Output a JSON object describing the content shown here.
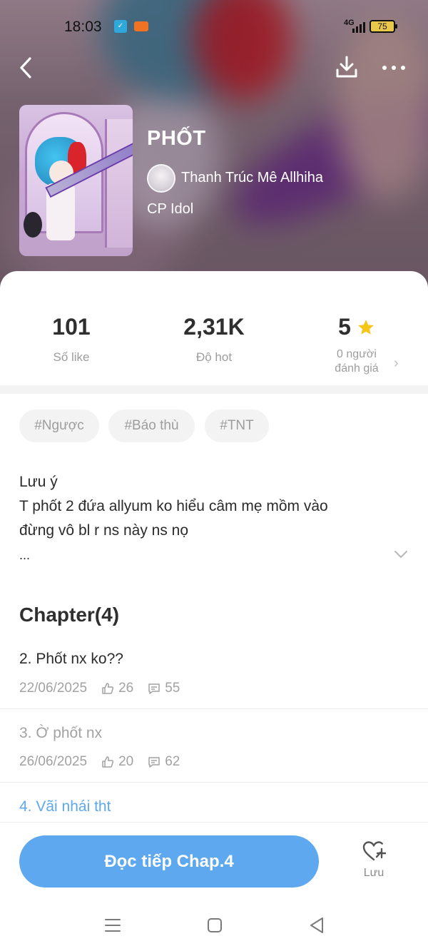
{
  "status_bar": {
    "time": "18:03",
    "network": "4G",
    "battery": "75"
  },
  "header": {
    "title": "PHỐT",
    "author": "Thanh Trúc Mê Allhiha",
    "category": "CP Idol"
  },
  "stats": [
    {
      "value": "101",
      "label": "Số like"
    },
    {
      "value": "2,31K",
      "label": "Độ hot"
    },
    {
      "value": "5",
      "label_line1": "0 người",
      "label_line2": "đánh giá"
    }
  ],
  "colors": {
    "accent": "#5da8ee",
    "star": "#f5c518",
    "link": "#5da8ee",
    "muted": "#9d9d9d"
  },
  "tags": [
    "#Ngược",
    "#Báo thù",
    "#TNT"
  ],
  "description": {
    "lines": [
      "Lưu ý",
      "T phốt 2 đứa allyum ko hiểu câm mẹ mồm vào",
      "đừng vô bl r ns này ns nọ",
      "..."
    ]
  },
  "chapters_header": "Chapter(4)",
  "chapters": [
    {
      "title": "2. Phốt nx ko??",
      "date": "22/06/2025",
      "likes": "26",
      "comments": "55"
    },
    {
      "title": "3. Ờ phốt nx",
      "date": "26/06/2025",
      "likes": "20",
      "comments": "62"
    },
    {
      "title": "4. Vãi nhái tht"
    }
  ],
  "bottom": {
    "read_button": "Đọc tiếp Chap.4",
    "save_label": "Lưu"
  },
  "icons": [
    "back-arrow-icon",
    "download-icon",
    "more-icon",
    "star-icon",
    "chevron-right-icon",
    "chevron-down-icon",
    "thumb-up-icon",
    "comment-icon",
    "heart-plus-icon",
    "menu-icon",
    "home-icon",
    "nav-back-icon"
  ]
}
